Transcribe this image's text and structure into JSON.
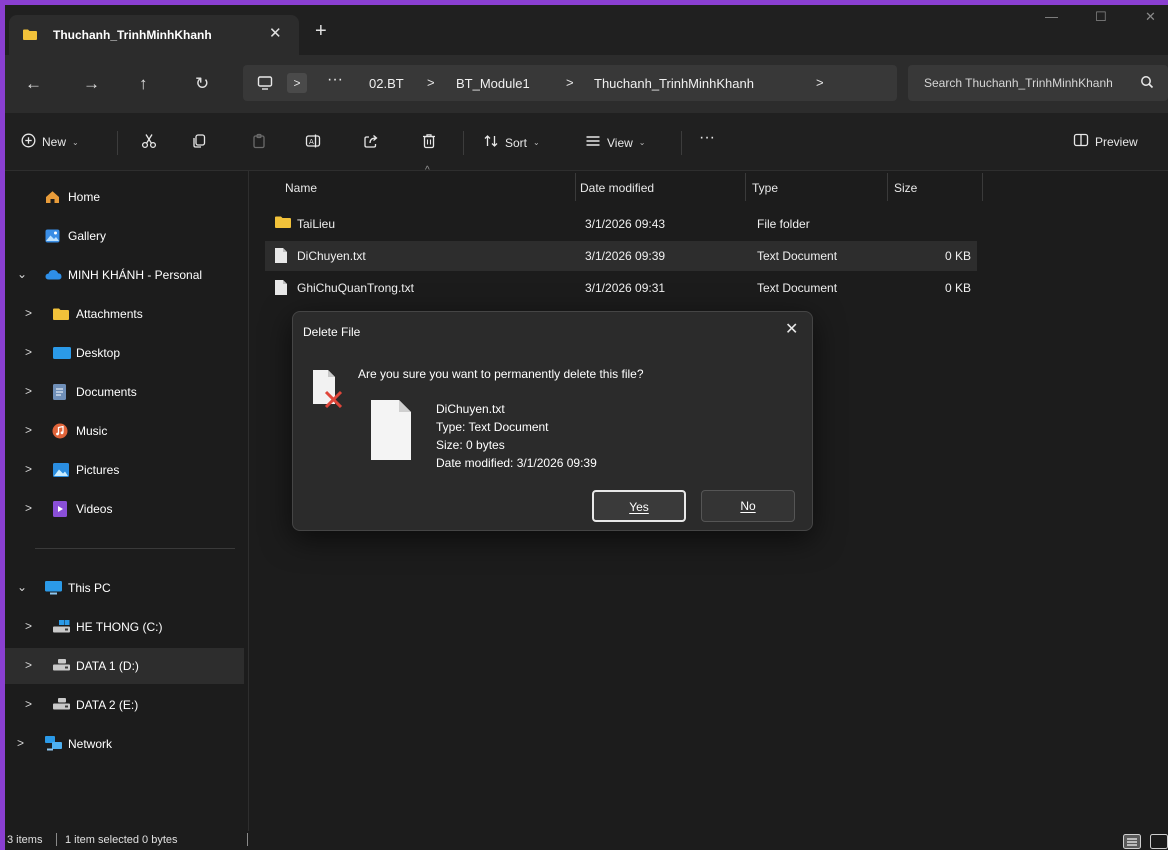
{
  "colors": {
    "window_bg": "#1c1c1c",
    "accent_border": "#8a3fd1",
    "folder_yellow": "#f2c23a",
    "selected_row": "#2d2d2d",
    "delete_red": "#e0463a"
  },
  "titlebar": {
    "tab_title": "Thuchanh_TrinhMinhKhanh",
    "tab_close": "✕",
    "new_tab": "+",
    "minimize": "—",
    "maximize": "☐",
    "close": "✕"
  },
  "nav": {
    "back": "←",
    "forward": "→",
    "up": "↑",
    "refresh": "↻"
  },
  "address": {
    "expand": ">",
    "more": "···",
    "breadcrumbs": [
      "02.BT",
      "BT_Module1",
      "Thuchanh_TrinhMinhKhanh"
    ],
    "sep": ">"
  },
  "search": {
    "placeholder": "Search Thuchanh_TrinhMinhKhanh"
  },
  "commands": {
    "new": "New",
    "sort": "Sort",
    "view": "View",
    "more": "···",
    "preview": "Preview",
    "caret": "⌄"
  },
  "sidebar": {
    "chev_right": ">",
    "chev_down": "⌄",
    "items": [
      {
        "label": "Home",
        "icon": "home-icon"
      },
      {
        "label": "Gallery",
        "icon": "gallery-icon"
      },
      {
        "label": "MINH KHÁNH - Personal",
        "icon": "onedrive-icon"
      },
      {
        "label": "Attachments",
        "icon": "folder-icon"
      },
      {
        "label": "Desktop",
        "icon": "desktop-icon"
      },
      {
        "label": "Documents",
        "icon": "documents-icon"
      },
      {
        "label": "Music",
        "icon": "music-icon"
      },
      {
        "label": "Pictures",
        "icon": "pictures-icon"
      },
      {
        "label": "Videos",
        "icon": "videos-icon"
      },
      {
        "label": "This PC",
        "icon": "pc-icon"
      },
      {
        "label": "HE THONG (C:)",
        "icon": "drive-c-icon"
      },
      {
        "label": "DATA 1 (D:)",
        "icon": "drive-icon"
      },
      {
        "label": "DATA 2 (E:)",
        "icon": "drive-icon"
      },
      {
        "label": "Network",
        "icon": "network-icon"
      }
    ]
  },
  "filelist": {
    "columns": [
      "Name",
      "Date modified",
      "Type",
      "Size"
    ],
    "sort_indicator": "^",
    "rows": [
      {
        "name": "TaiLieu",
        "date": "3/1/2026 09:43",
        "type": "File folder",
        "size": "",
        "kind": "folder"
      },
      {
        "name": "DiChuyen.txt",
        "date": "3/1/2026 09:39",
        "type": "Text Document",
        "size": "0 KB",
        "kind": "file"
      },
      {
        "name": "GhiChuQuanTrong.txt",
        "date": "3/1/2026 09:31",
        "type": "Text Document",
        "size": "0 KB",
        "kind": "file"
      }
    ]
  },
  "dialog": {
    "title": "Delete File",
    "close": "✕",
    "question": "Are you sure you want to permanently delete this file?",
    "file_name": "DiChuyen.txt",
    "file_type": "Type: Text Document",
    "file_size": "Size: 0 bytes",
    "file_date": "Date modified: 3/1/2026 09:39",
    "yes": "Yes",
    "no": "No"
  },
  "status": {
    "items": "3 items",
    "selected": "1 item selected  0 bytes"
  }
}
